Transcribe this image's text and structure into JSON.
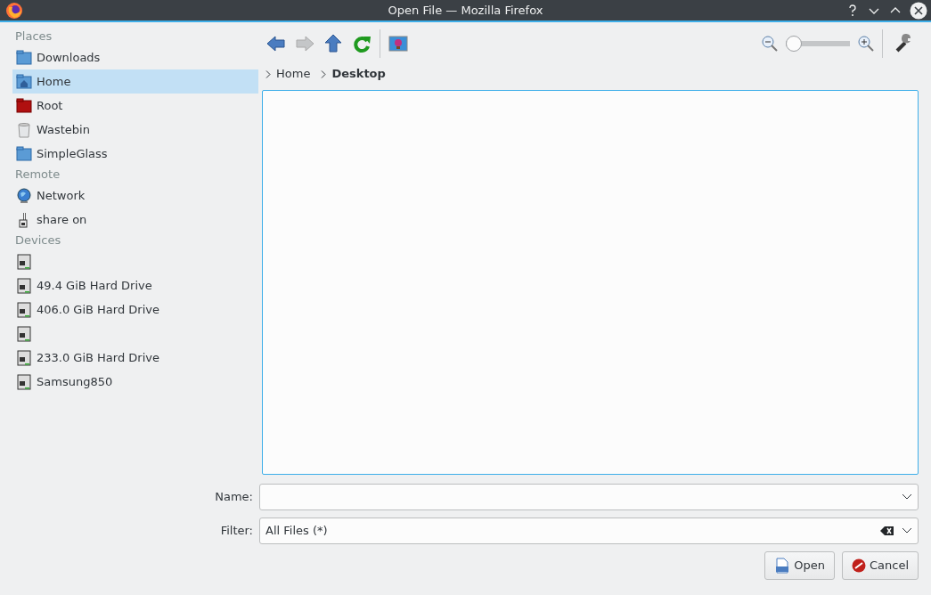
{
  "window": {
    "title": "Open File — Mozilla Firefox"
  },
  "sidebar": {
    "sections": [
      {
        "heading": "Places",
        "items": [
          {
            "kind": "folder",
            "label": "Downloads",
            "selected": false
          },
          {
            "kind": "home",
            "label": "Home",
            "selected": true
          },
          {
            "kind": "root",
            "label": "Root",
            "selected": false
          },
          {
            "kind": "bin",
            "label": "Wastebin",
            "selected": false
          },
          {
            "kind": "folder",
            "label": "SimpleGlass",
            "selected": false
          }
        ]
      },
      {
        "heading": "Remote",
        "items": [
          {
            "kind": "network",
            "label": "Network",
            "selected": false
          },
          {
            "kind": "share",
            "label": "share on",
            "selected": false
          }
        ]
      },
      {
        "heading": "Devices",
        "items": [
          {
            "kind": "drive",
            "selected": false
          },
          {
            "kind": "drive",
            "label": "49.4 GiB Hard Drive",
            "selected": false
          },
          {
            "kind": "drive",
            "label": "406.0 GiB Hard Drive",
            "selected": false
          },
          {
            "kind": "drive",
            "selected": false
          },
          {
            "kind": "drive",
            "label": "233.0 GiB Hard Drive",
            "selected": false
          },
          {
            "kind": "drive",
            "label": "Samsung850",
            "selected": false
          }
        ]
      }
    ]
  },
  "toolbar": {
    "forward_disabled": true,
    "zoom": {
      "level": 0.0
    }
  },
  "breadcrumb": [
    {
      "label": "Home",
      "current": false
    },
    {
      "label": "Desktop",
      "current": true
    }
  ],
  "name_field": {
    "label": "Name:"
  },
  "filter_field": {
    "label": "Filter:",
    "value": "All Files (*)"
  },
  "buttons": [
    {
      "kind": "open",
      "label": "Open"
    },
    {
      "kind": "cancel",
      "label": "Cancel"
    }
  ]
}
